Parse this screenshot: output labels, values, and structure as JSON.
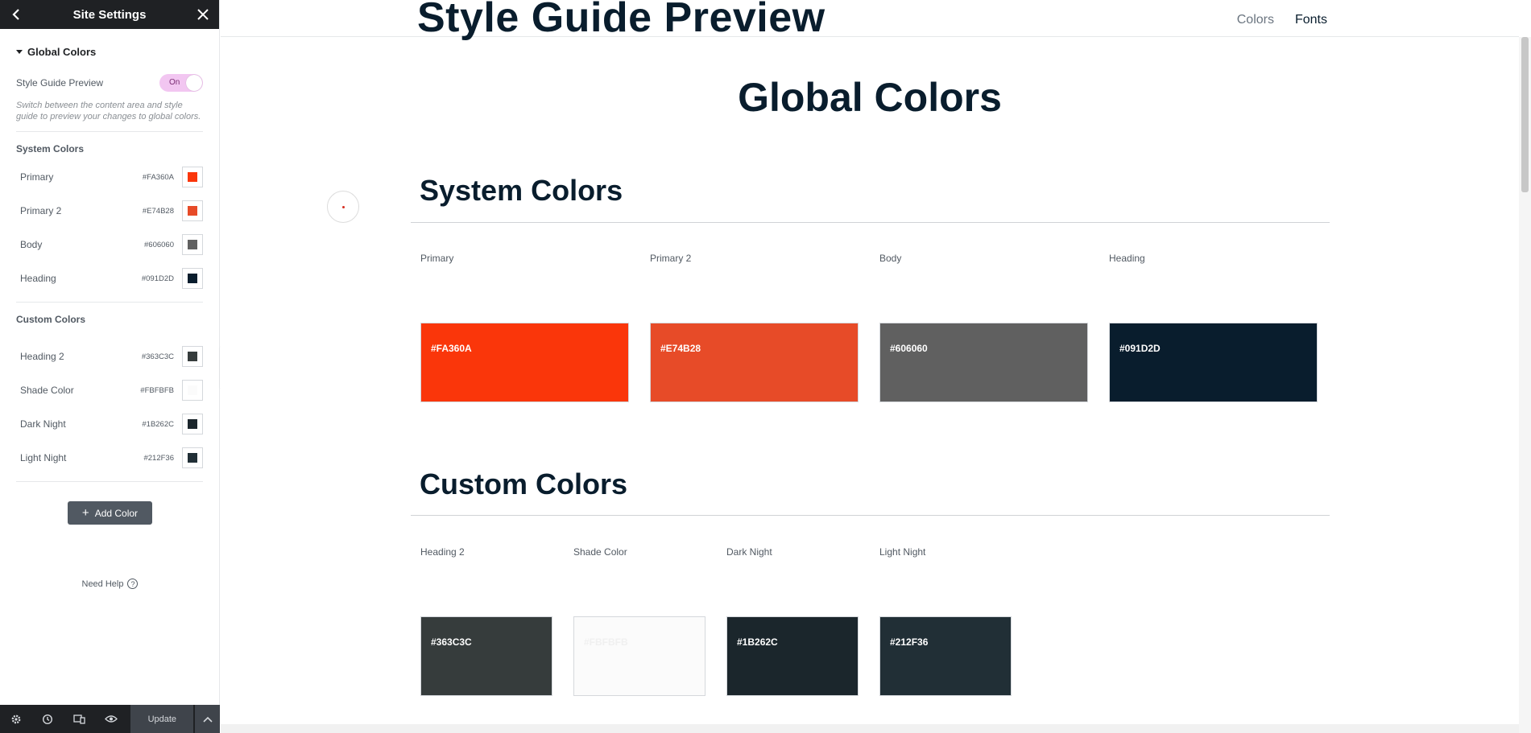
{
  "panel": {
    "title": "Site Settings",
    "back_icon": "chevron-left-icon",
    "close_icon": "close-icon",
    "section_title": "Global Colors",
    "style_guide_label": "Style Guide Preview",
    "toggle_state": "On",
    "description": "Switch between the content area and style guide to preview your changes to global colors.",
    "system_title": "System Colors",
    "system_colors": [
      {
        "name": "Primary",
        "hex": "#FA360A",
        "color": "#FA360A"
      },
      {
        "name": "Primary 2",
        "hex": "#E74B28",
        "color": "#E74B28"
      },
      {
        "name": "Body",
        "hex": "#606060",
        "color": "#606060"
      },
      {
        "name": "Heading",
        "hex": "#091D2D",
        "color": "#091D2D"
      }
    ],
    "custom_title": "Custom Colors",
    "custom_colors": [
      {
        "name": "Heading 2",
        "hex": "#363C3C",
        "color": "#363C3C"
      },
      {
        "name": "Shade Color",
        "hex": "#FBFBFB",
        "color": "#FBFBFB"
      },
      {
        "name": "Dark Night",
        "hex": "#1B262C",
        "color": "#1B262C"
      },
      {
        "name": "Light Night",
        "hex": "#212F36",
        "color": "#212F36"
      }
    ],
    "add_color_label": "Add Color",
    "need_help_label": "Need Help"
  },
  "footer": {
    "update_label": "Update",
    "icons": [
      "gear-icon",
      "history-icon",
      "responsive-icon",
      "eye-icon",
      "chevron-up-icon"
    ]
  },
  "preview": {
    "page_title": "Style Guide Preview",
    "nav": [
      "Colors",
      "Fonts"
    ],
    "heading": "Global Colors",
    "system_heading": "System Colors",
    "custom_heading": "Custom Colors"
  }
}
